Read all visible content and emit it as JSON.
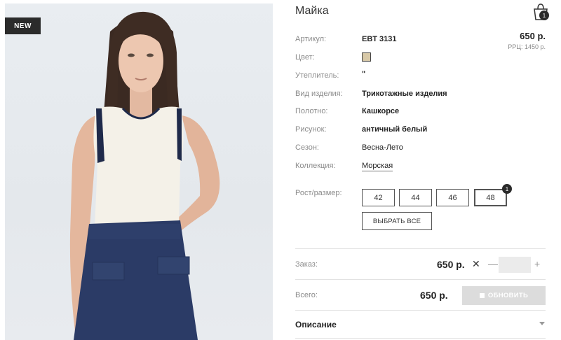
{
  "badge": "NEW",
  "product": {
    "title": "Майка",
    "price": "650 р.",
    "rrc": "РРЦ: 1450 р.",
    "swatch_color": "#d8c9a8"
  },
  "cart": {
    "count": "1"
  },
  "specs": [
    {
      "label": "Артикул:",
      "value": "EBT 3131"
    },
    {
      "label": "Цвет:",
      "value": ""
    },
    {
      "label": "Утеплитель:",
      "value": "\""
    },
    {
      "label": "Вид изделия:",
      "value": "Трикотажные изделия"
    },
    {
      "label": "Полотно:",
      "value": "Кашкорсе"
    },
    {
      "label": "Рисунок:",
      "value": "античный белый"
    },
    {
      "label": "Сезон:",
      "value": "Весна-Лето"
    },
    {
      "label": "Коллекция:",
      "value": "Морская"
    }
  ],
  "sizes": {
    "label": "Рост/размер:",
    "options": [
      "42",
      "44",
      "46",
      "48"
    ],
    "selected": "48",
    "selected_count": "1",
    "select_all": "ВЫБРАТЬ ВСЕ"
  },
  "order": {
    "label": "Заказ:",
    "price": "650 р.",
    "times": "✕",
    "minus": "—",
    "plus": "+",
    "qty": ""
  },
  "total": {
    "label": "Всего:",
    "price": "650 р.",
    "update": "ОБНОВИТЬ"
  },
  "description": {
    "title": "Описание"
  }
}
